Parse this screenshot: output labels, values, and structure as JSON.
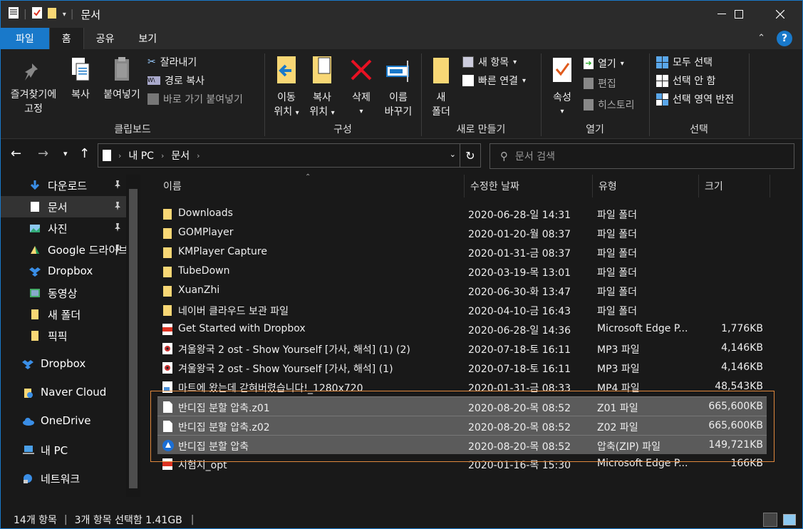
{
  "window": {
    "title": "문서"
  },
  "ribbon_tabs": [
    "파일",
    "홈",
    "공유",
    "보기"
  ],
  "ribbon": {
    "pin_label_1": "즐겨찾기에",
    "pin_label_2": "고정",
    "copy": "복사",
    "paste": "붙여넣기",
    "cut": "잘라내기",
    "copy_path": "경로 복사",
    "paste_shortcut": "바로 가기 붙여넣기",
    "clipboard_group": "클립보드",
    "move_to_1": "이동",
    "move_to_2": "위치",
    "copy_to_1": "복사",
    "copy_to_2": "위치",
    "delete": "삭제",
    "rename_1": "이름",
    "rename_2": "바꾸기",
    "organize_group": "구성",
    "new_folder_1": "새",
    "new_folder_2": "폴더",
    "new_item": "새 항목",
    "easy_access": "빠른 연결",
    "new_group": "새로 만들기",
    "properties": "속성",
    "open": "열기",
    "edit": "편집",
    "history": "히스토리",
    "open_group": "열기",
    "select_all": "모두 선택",
    "select_none": "선택 안 함",
    "invert_selection": "선택 영역 반전",
    "select_group": "선택"
  },
  "address": {
    "pc": "내 PC",
    "folder": "문서",
    "search_placeholder": "문서 검색"
  },
  "nav": [
    {
      "label": "다운로드",
      "pinned": true
    },
    {
      "label": "문서",
      "pinned": true,
      "selected": true
    },
    {
      "label": "사진",
      "pinned": true
    },
    {
      "label": "Google 드라이브",
      "pinned": true
    },
    {
      "label": "Dropbox"
    },
    {
      "label": "동영상"
    },
    {
      "label": "새 폴더"
    },
    {
      "label": "픽픽"
    },
    {
      "label": "Dropbox"
    },
    {
      "label": "Naver Cloud"
    },
    {
      "label": "OneDrive"
    },
    {
      "label": "내 PC"
    },
    {
      "label": "네트워크"
    }
  ],
  "columns": {
    "name": "이름",
    "date": "수정한 날짜",
    "type": "유형",
    "size": "크기"
  },
  "files": [
    {
      "name": "Downloads",
      "date": "2020-06-28-일 14:31",
      "type": "파일 폴더",
      "size": "",
      "icon": "folder"
    },
    {
      "name": "GOMPlayer",
      "date": "2020-01-20-월 08:37",
      "type": "파일 폴더",
      "size": "",
      "icon": "folder"
    },
    {
      "name": "KMPlayer Capture",
      "date": "2020-01-31-금 08:37",
      "type": "파일 폴더",
      "size": "",
      "icon": "folder"
    },
    {
      "name": "TubeDown",
      "date": "2020-03-19-목 13:01",
      "type": "파일 폴더",
      "size": "",
      "icon": "folder"
    },
    {
      "name": "XuanZhi",
      "date": "2020-06-30-화 13:47",
      "type": "파일 폴더",
      "size": "",
      "icon": "folder"
    },
    {
      "name": "네이버 클라우드 보관 파일",
      "date": "2020-04-10-금 16:43",
      "type": "파일 폴더",
      "size": "",
      "icon": "folder"
    },
    {
      "name": "Get Started with Dropbox",
      "date": "2020-06-28-일 14:36",
      "type": "Microsoft Edge P...",
      "size": "1,776KB",
      "icon": "pdf"
    },
    {
      "name": "겨울왕국 2 ost - Show Yourself [가사, 해석] (1) (2)",
      "date": "2020-07-18-토 16:11",
      "type": "MP3 파일",
      "size": "4,146KB",
      "icon": "mp3"
    },
    {
      "name": "겨울왕국 2 ost - Show Yourself [가사, 해석] (1)",
      "date": "2020-07-18-토 16:11",
      "type": "MP3 파일",
      "size": "4,146KB",
      "icon": "mp3"
    },
    {
      "name": "마트에 왔는데  갇혀버렸습니다!_1280x720",
      "date": "2020-01-31-금 08:33",
      "type": "MP4 파일",
      "size": "48,543KB",
      "icon": "mp4"
    },
    {
      "name": "반디집 분할 압축.z01",
      "date": "2020-08-20-목 08:52",
      "type": "Z01 파일",
      "size": "665,600KB",
      "icon": "file",
      "selected": true
    },
    {
      "name": "반디집 분할 압축.z02",
      "date": "2020-08-20-목 08:52",
      "type": "Z02 파일",
      "size": "665,600KB",
      "icon": "file",
      "selected": true
    },
    {
      "name": "반디집 분할 압축",
      "date": "2020-08-20-목 08:52",
      "type": "압축(ZIP) 파일",
      "size": "149,721KB",
      "icon": "zip",
      "selected": true
    },
    {
      "name": "시험지_opt",
      "date": "2020-01-16-목 15:30",
      "type": "Microsoft Edge P...",
      "size": "166KB",
      "icon": "pdf"
    }
  ],
  "status": {
    "count": "14개 항목",
    "selected": "3개 항목 선택함 1.41GB"
  }
}
